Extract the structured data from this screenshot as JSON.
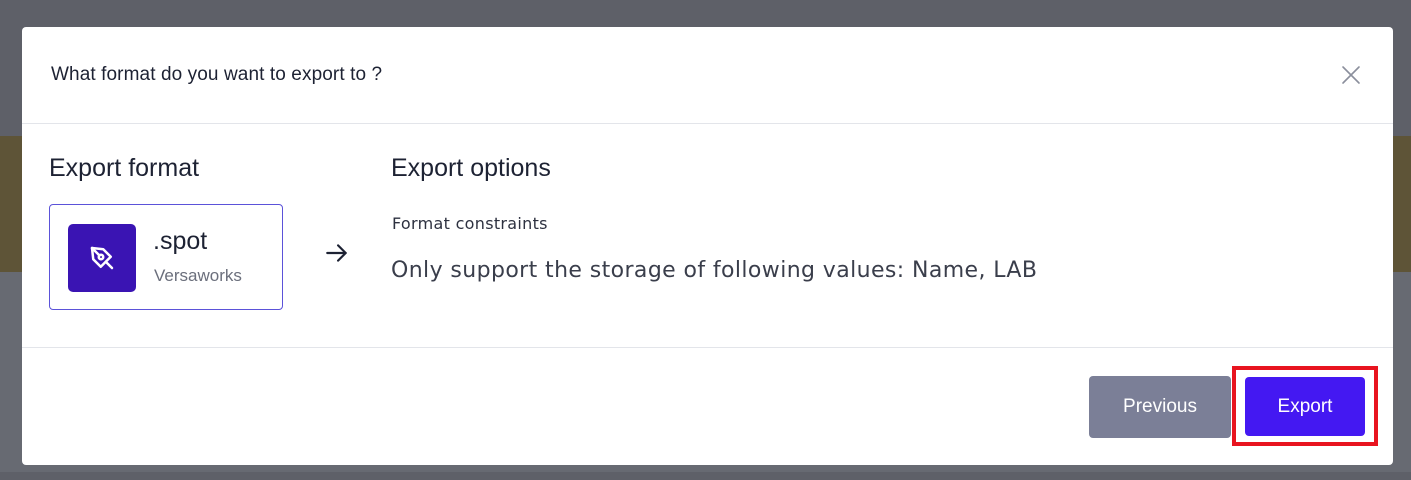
{
  "dialog": {
    "title": "What format do you want to export to ?",
    "close_icon": "close-icon"
  },
  "export_format": {
    "heading": "Export format",
    "selected": {
      "icon": "pen-tool-icon",
      "icon_color": "#3a14b3",
      "extension": ".spot",
      "application": "Versaworks"
    }
  },
  "export_options": {
    "heading": "Export options",
    "constraints_label": "Format constraints",
    "constraints_text": "Only support the storage of following values: Name, LAB"
  },
  "footer": {
    "previous_label": "Previous",
    "export_label": "Export"
  },
  "colors": {
    "accent": "#4418f2",
    "secondary_button": "#7b7f97",
    "highlight": "#e8141f"
  }
}
